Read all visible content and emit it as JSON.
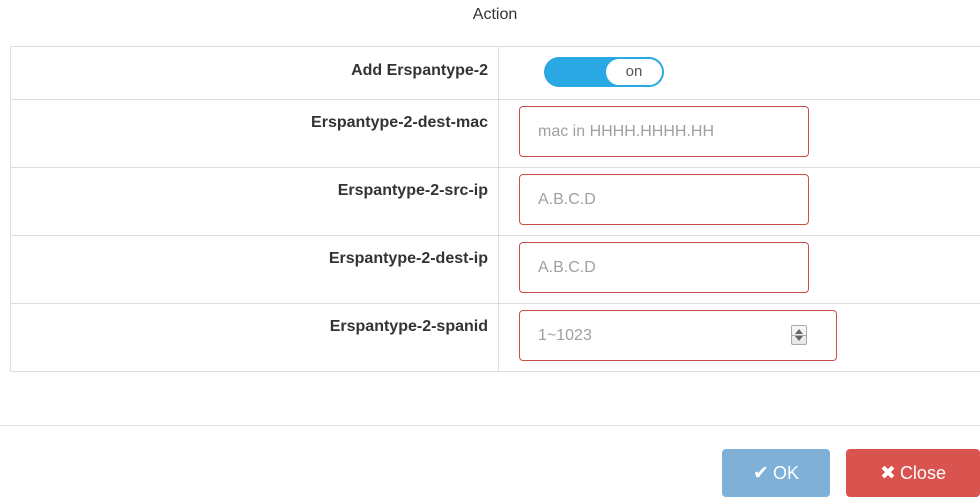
{
  "section": {
    "title": "Action"
  },
  "form": {
    "add_erspan": {
      "label": "Add Erspantype-2",
      "toggle_state": "on"
    },
    "dest_mac": {
      "label": "Erspantype-2-dest-mac",
      "value": "",
      "placeholder": "mac in HHHH.HHHH.HH"
    },
    "src_ip": {
      "label": "Erspantype-2-src-ip",
      "value": "",
      "placeholder": "A.B.C.D"
    },
    "dest_ip": {
      "label": "Erspantype-2-dest-ip",
      "value": "",
      "placeholder": "A.B.C.D"
    },
    "spanid": {
      "label": "Erspantype-2-spanid",
      "value": "",
      "placeholder": "1~1023"
    }
  },
  "footer": {
    "ok_label": "OK",
    "ok_icon": "checkmark-icon",
    "close_label": "Close",
    "close_icon": "x-icon"
  },
  "colors": {
    "toggle_on": "#2aa8e4",
    "input_error_border": "#c9504a",
    "ok_button": "#7eb0d8",
    "close_button": "#d9534f"
  }
}
